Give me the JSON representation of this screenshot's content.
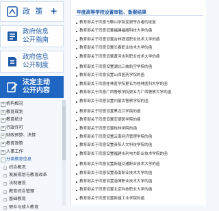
{
  "sidebar": {
    "policy": "政  策",
    "guide": [
      "政府信息",
      "公开指南"
    ],
    "regulation": [
      "政府信息",
      "公开制度"
    ],
    "mandatory": [
      "法定主动",
      "公开内容"
    ],
    "tree": [
      {
        "label": "机构概况",
        "box": "+"
      },
      {
        "label": "教育规划",
        "box": "+"
      },
      {
        "label": "教育统计",
        "box": "+"
      },
      {
        "label": "行政许可",
        "box": "+"
      },
      {
        "label": "财政预算、决算",
        "box": "+"
      },
      {
        "label": "教育政策",
        "box": "+"
      },
      {
        "label": "人事工作",
        "box": "+"
      },
      {
        "label": "分类教育信息",
        "box": "-",
        "active": true
      },
      {
        "label": "综合概况",
        "sub": true
      },
      {
        "label": "发展规划与教育改革",
        "sub": true
      },
      {
        "label": "法制建设",
        "sub": true
      },
      {
        "label": "教育综合管理",
        "sub": true
      },
      {
        "label": "基础教育",
        "sub": true
      },
      {
        "label": "职业与成人教育",
        "sub": true
      }
    ]
  },
  "main": {
    "heading": "年度高等学校设置审批、备案结果",
    "items": [
      "教育部关于同意马鞍山学院变更举办者的批复",
      "教育部关于同意设置福建福耀科技大学的函",
      "教育部关于同意设置吉林铁道职业技术大学的函",
      "教育部关于同意设置长春职业技术大学的函",
      "教育部关于同意设置黄河水利职业技术大学的函",
      "",
      "教育部关于同意设置湖北三峡航空学院的函",
      "教育部关于同意设置山西医药学院的函",
      "教育部关于同意桂林医学院更名为桂林医科大学的函",
      "教育部关于同意广西警察学院更名为广西警察大学的函",
      "教育部关于同意设置内蒙古警察学院的函",
      "",
      "教育部关于同意设置黑龙江学院的函",
      "教育部关于同意设置宏德医学院的函",
      "教育部关于同意设置桂林学院的函",
      "教育部关于同意设置云南经济管理学院的函",
      "教育部关于同意设置贵阳人文科技学院的函",
      "教育部关于同意设置福建水利电力职业技术学院的函",
      "",
      "教育部关于同意设置新疆交通职业技术大学的函",
      "教育部关于同意设置海南职业技术大学的函",
      "教育部关于同意设置淄博职业技术大学的函",
      "教育部关于同意设置北京科技职业大学的函",
      "教育部关于同意设置新疆工业学院的函"
    ]
  },
  "colors": {
    "accent": "#1d5aa8",
    "active_bg": "#1f65c2"
  }
}
